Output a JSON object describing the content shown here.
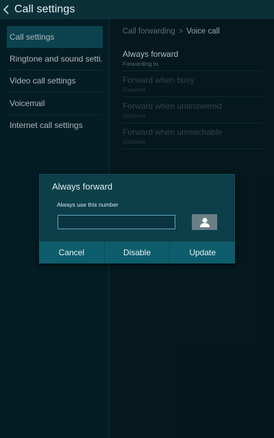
{
  "appbar": {
    "title": "Call settings",
    "back_icon": "chevron-left-icon"
  },
  "sidebar": {
    "items": [
      {
        "label": "Call settings",
        "selected": true
      },
      {
        "label": "Ringtone and sound setti..",
        "selected": false
      },
      {
        "label": "Video call settings",
        "selected": false
      },
      {
        "label": "Voicemail",
        "selected": false
      },
      {
        "label": "Internet call settings",
        "selected": false
      }
    ]
  },
  "breadcrumb": {
    "parent": "Call forwarding",
    "separator": ">",
    "current": "Voice call"
  },
  "forwarding": {
    "items": [
      {
        "title": "Always forward",
        "status": "Forwarding to",
        "enabled": true
      },
      {
        "title": "Forward when busy",
        "status": "Disabled",
        "enabled": false
      },
      {
        "title": "Forward when unanswered",
        "status": "Disabled",
        "enabled": false
      },
      {
        "title": "Forward when unreachable",
        "status": "Disabled",
        "enabled": false
      }
    ]
  },
  "dialog": {
    "title": "Always forward",
    "field_label": "Always use this number",
    "field_value": "",
    "contact_icon": "contact-person-icon",
    "buttons": {
      "cancel": "Cancel",
      "disable": "Disable",
      "update": "Update"
    }
  },
  "colors": {
    "appbar": "#0b3038",
    "selected_item": "#0f5463",
    "dialog_bg": "#0c3f4a",
    "dialog_buttons": "#0e5d6c",
    "input_border": "#5fa9bd"
  }
}
